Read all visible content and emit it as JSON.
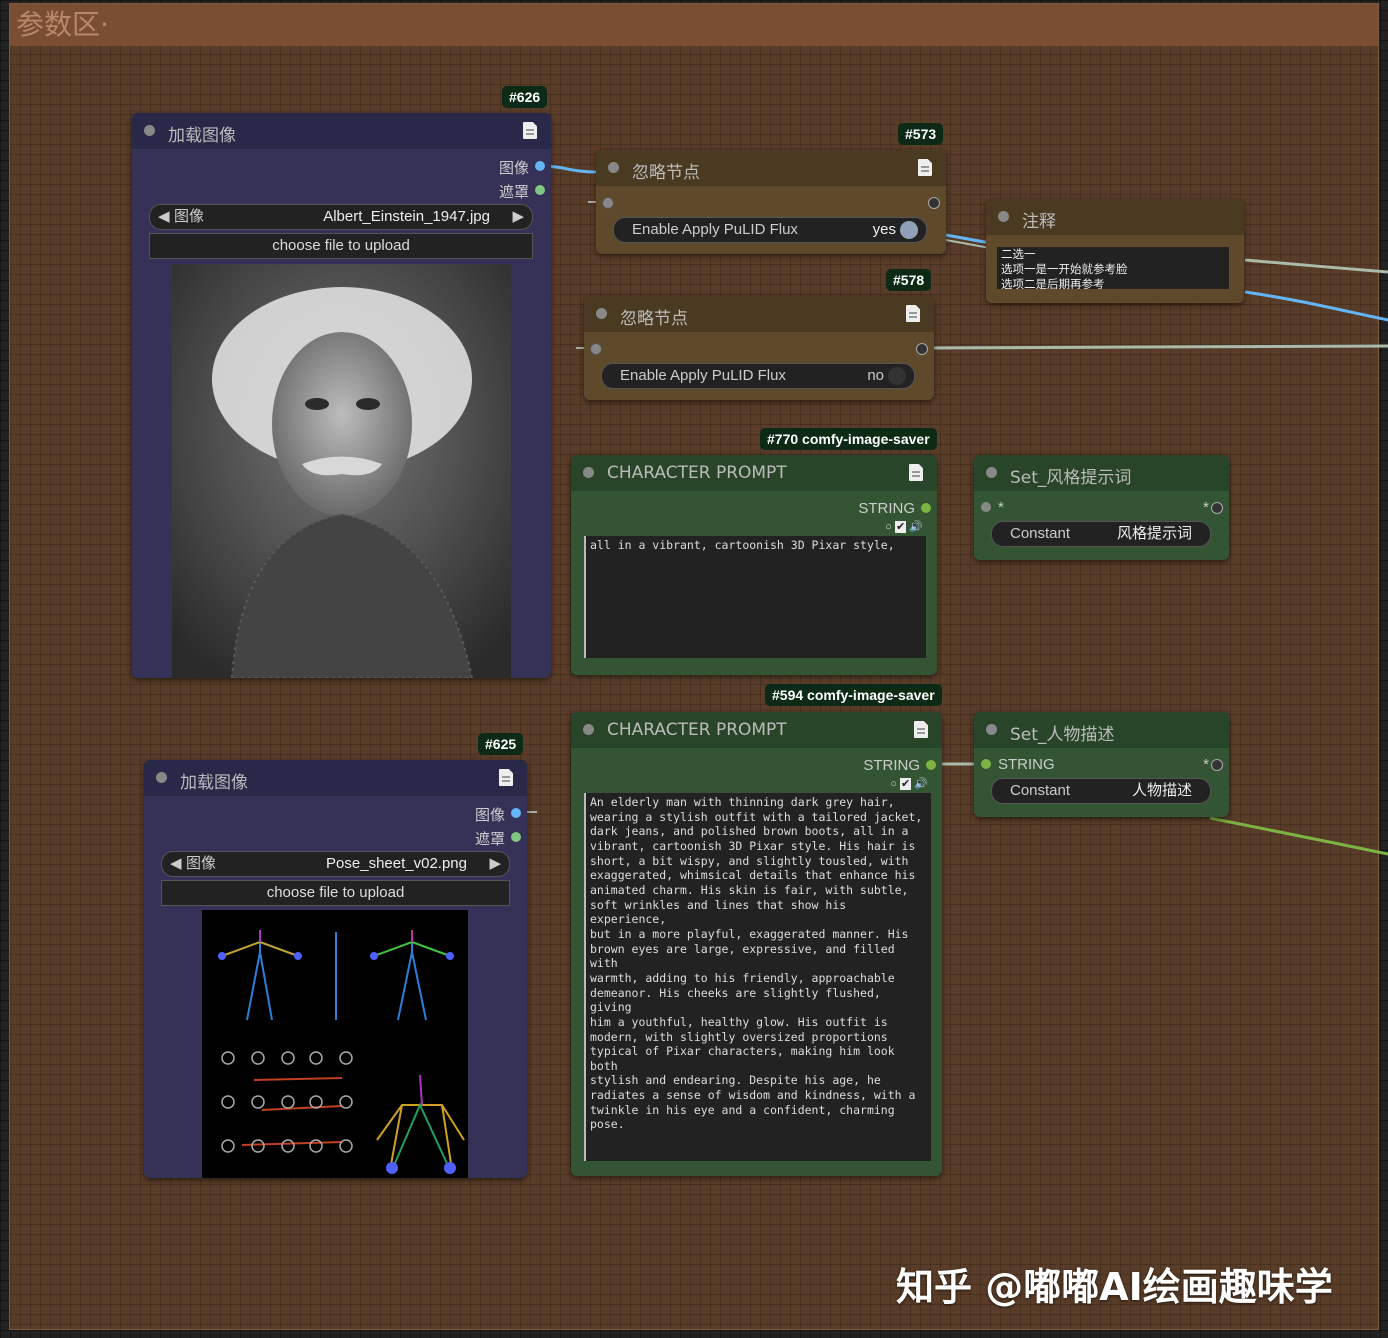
{
  "group": {
    "title": "参数区·"
  },
  "nodes": {
    "load1": {
      "badge": "#626",
      "title": "加载图像",
      "out_image": "图像",
      "out_mask": "遮罩",
      "combo_label": "图像",
      "combo_value": "Albert_Einstein_1947.jpg",
      "upload": "choose file to upload"
    },
    "load2": {
      "badge": "#625",
      "title": "加载图像",
      "out_image": "图像",
      "out_mask": "遮罩",
      "combo_label": "图像",
      "combo_value": "Pose_sheet_v02.png",
      "upload": "choose file to upload"
    },
    "ignore1": {
      "badge": "#573",
      "title": "忽略节点",
      "toggle_label": "Enable Apply PuLID Flux",
      "toggle_value": "yes"
    },
    "ignore2": {
      "badge": "#578",
      "title": "忽略节点",
      "toggle_label": "Enable Apply PuLID Flux",
      "toggle_value": "no"
    },
    "note": {
      "title": "注释",
      "text": "二选一\n选项一是一开始就参考脸\n选项二是后期再参考"
    },
    "prompt1": {
      "badge": "#770 comfy-image-saver",
      "title": "CHARACTER PROMPT",
      "out": "STRING",
      "text": "all in a vibrant, cartoonish 3D Pixar style,"
    },
    "prompt2": {
      "badge": "#594 comfy-image-saver",
      "title": "CHARACTER PROMPT",
      "out": "STRING",
      "text": "An elderly man with thinning dark grey hair,\nwearing a stylish outfit with a tailored jacket,\ndark jeans, and polished brown boots, all in a\nvibrant, cartoonish 3D Pixar style. His hair is\nshort, a bit wispy, and slightly tousled, with\nexaggerated, whimsical details that enhance his\nanimated charm. His skin is fair, with subtle,\nsoft wrinkles and lines that show his experience,\nbut in a more playful, exaggerated manner. His\nbrown eyes are large, expressive, and filled with\nwarmth, adding to his friendly, approachable\ndemeanor. His cheeks are slightly flushed, giving\nhim a youthful, healthy glow. His outfit is\nmodern, with slightly oversized proportions\ntypical of Pixar characters, making him look both\nstylish and endearing. Despite his age, he\nradiates a sense of wisdom and kindness, with a\ntwinkle in his eye and a confident, charming pose."
    },
    "set1": {
      "title": "Set_风格提示词",
      "in_label": "*",
      "out_label": "*",
      "const_label": "Constant",
      "const_value": "风格提示词"
    },
    "set2": {
      "title": "Set_人物描述",
      "in_label": "STRING",
      "out_label": "*",
      "const_label": "Constant",
      "const_value": "人物描述"
    }
  },
  "watermark": "知乎 @嘟嘟AI绘画趣味学",
  "colors": {
    "group_bg": "#5a3d28",
    "group_title": "#7a4e33",
    "load_node": "#353157",
    "ignore_node": "#5e4a2b",
    "prompt_node": "#335533",
    "wire_image": "#64b5f6",
    "wire_string": "#7cb342"
  }
}
